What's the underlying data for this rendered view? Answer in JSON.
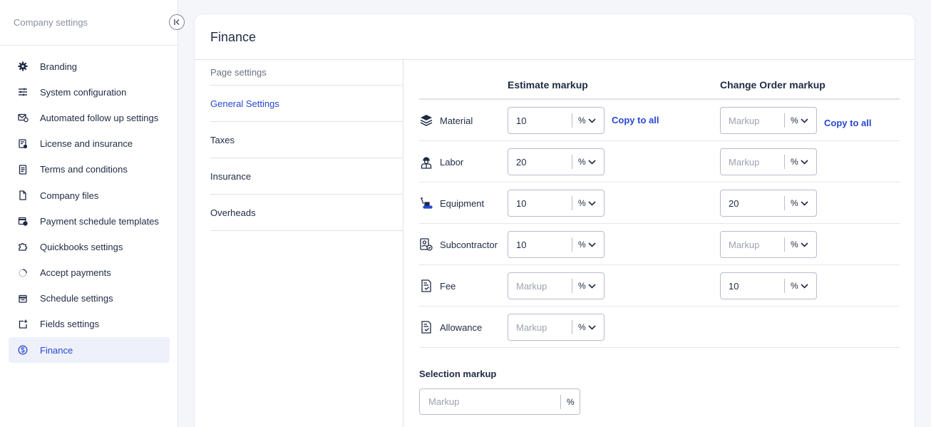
{
  "sidebar": {
    "title": "Company settings",
    "items": [
      {
        "label": "Branding",
        "icon": "gear-icon"
      },
      {
        "label": "System configuration",
        "icon": "sliders-icon"
      },
      {
        "label": "Automated follow up settings",
        "icon": "mail-clock-icon"
      },
      {
        "label": "License and insurance",
        "icon": "certificate-icon"
      },
      {
        "label": "Terms and conditions",
        "icon": "document-lines-icon"
      },
      {
        "label": "Company files",
        "icon": "file-icon"
      },
      {
        "label": "Payment schedule templates",
        "icon": "calendar-clock-icon"
      },
      {
        "label": "Quickbooks settings",
        "icon": "puzzle-icon"
      },
      {
        "label": "Accept payments",
        "icon": "spinner-icon"
      },
      {
        "label": "Schedule settings",
        "icon": "calendar-icon"
      },
      {
        "label": "Fields settings",
        "icon": "field-add-icon"
      },
      {
        "label": "Finance",
        "icon": "dollar-circle-icon",
        "active": true
      }
    ]
  },
  "main": {
    "title": "Finance",
    "subnav": {
      "heading": "Page settings",
      "items": [
        {
          "label": "General Settings",
          "active": true
        },
        {
          "label": "Taxes"
        },
        {
          "label": "Insurance"
        },
        {
          "label": "Overheads"
        }
      ]
    },
    "columns": {
      "estimate": "Estimate markup",
      "change_order": "Change Order markup"
    },
    "copy_label": "Copy to all",
    "unit": "%",
    "placeholder": "Markup",
    "rows": [
      {
        "label": "Material",
        "icon": "layers-icon",
        "estimate": "10",
        "change_order": ""
      },
      {
        "label": "Labor",
        "icon": "worker-icon",
        "estimate": "20",
        "change_order": ""
      },
      {
        "label": "Equipment",
        "icon": "excavator-icon",
        "estimate": "10",
        "change_order": "20"
      },
      {
        "label": "Subcontractor",
        "icon": "subcontractor-icon",
        "estimate": "10",
        "change_order": ""
      },
      {
        "label": "Fee",
        "icon": "receipt-check-icon",
        "estimate": "",
        "change_order": "10"
      },
      {
        "label": "Allowance",
        "icon": "receipt-check-icon",
        "estimate": "",
        "change_order": null
      }
    ],
    "selection": {
      "title": "Selection markup",
      "placeholder": "Markup",
      "unit": "%"
    }
  },
  "colors": {
    "accent": "#2747d4",
    "text": "#1f2a44",
    "muted": "#8a90a2",
    "border": "#dfe2ea",
    "background": "#f5f6fa"
  }
}
